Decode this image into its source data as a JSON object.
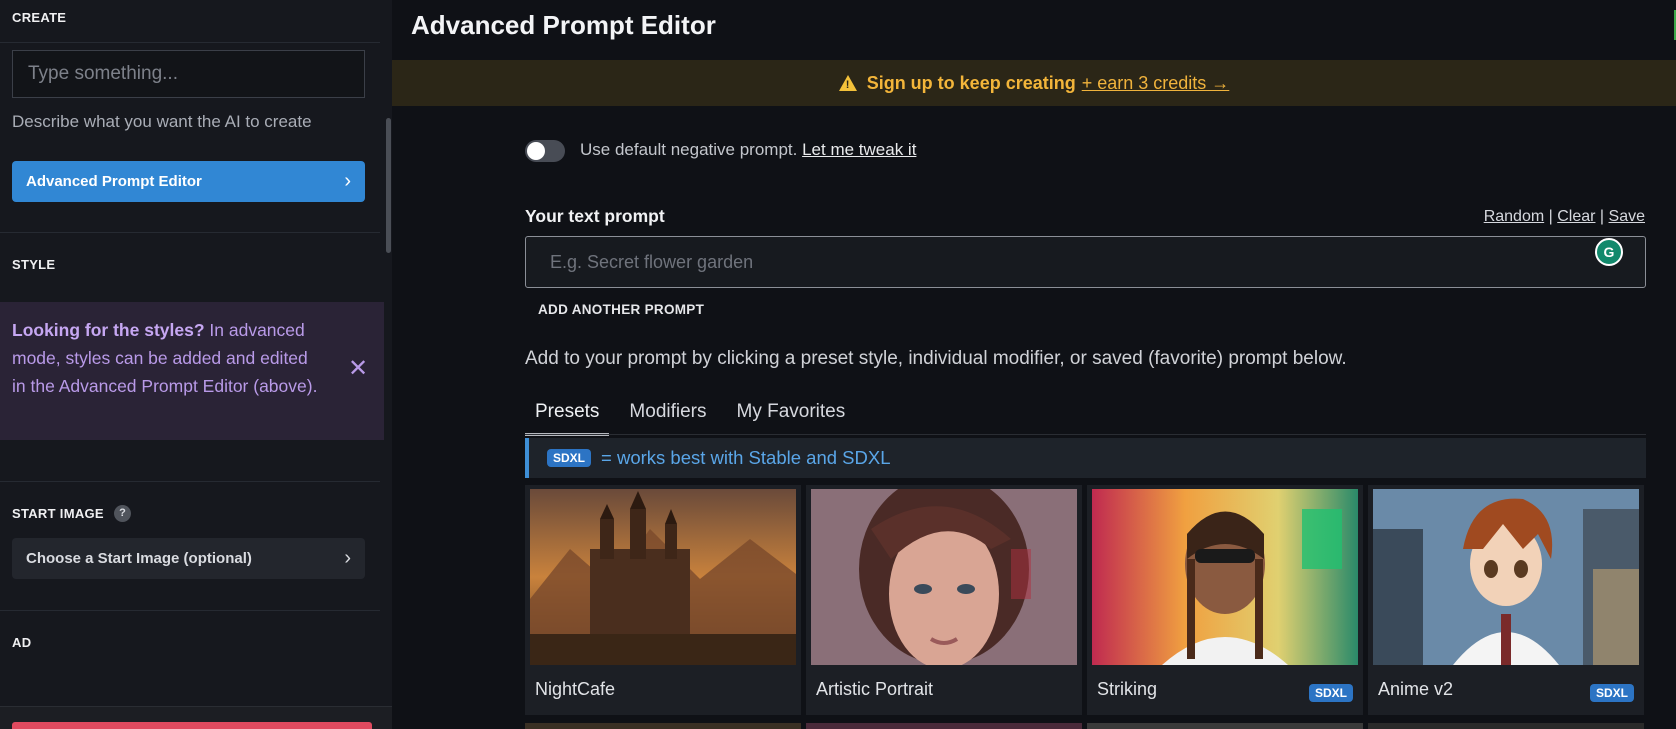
{
  "sidebar": {
    "create_title": "CREATE",
    "prompt_placeholder": "Type something...",
    "helper_text": "Describe what you want the AI to create",
    "ape_button_label": "Advanced Prompt Editor",
    "style_title": "STYLE",
    "styles_notice_bold": "Looking for the styles?",
    "styles_notice_text": " In advanced mode, styles can be added and edited in the Advanced Prompt Editor (above).",
    "start_image_title": "START IMAGE",
    "start_image_button_label": "Choose a Start Image (optional)",
    "ad_title": "AD"
  },
  "main": {
    "title": "Advanced Prompt Editor",
    "banner": {
      "text": "Sign up to keep creating",
      "link": "+ earn 3 credits →"
    },
    "negative_prompt": {
      "text": "Use default negative prompt.",
      "link": "Let me tweak it",
      "enabled": false
    },
    "prompt_label": "Your text prompt",
    "prompt_actions": {
      "random": "Random",
      "clear": "Clear",
      "save": "Save"
    },
    "prompt_placeholder": "E.g. Secret flower garden",
    "add_prompt_label": "ADD ANOTHER PROMPT",
    "add_to_prompt_text": "Add to your prompt by clicking a preset style, individual modifier, or saved (favorite) prompt below.",
    "tabs": [
      {
        "label": "Presets",
        "active": true
      },
      {
        "label": "Modifiers",
        "active": false
      },
      {
        "label": "My Favorites",
        "active": false
      }
    ],
    "sdxl_badge": "SDXL",
    "sdxl_note": "= works best with Stable and SDXL",
    "presets": [
      {
        "name": "NightCafe",
        "sdxl": false
      },
      {
        "name": "Artistic Portrait",
        "sdxl": false
      },
      {
        "name": "Striking",
        "sdxl": true
      },
      {
        "name": "Anime v2",
        "sdxl": true
      }
    ]
  },
  "colors": {
    "accent": "#3187d4",
    "banner_text": "#f3b53a",
    "notice_text": "#b99ae8",
    "sdxl_text": "#5aa6e8"
  }
}
